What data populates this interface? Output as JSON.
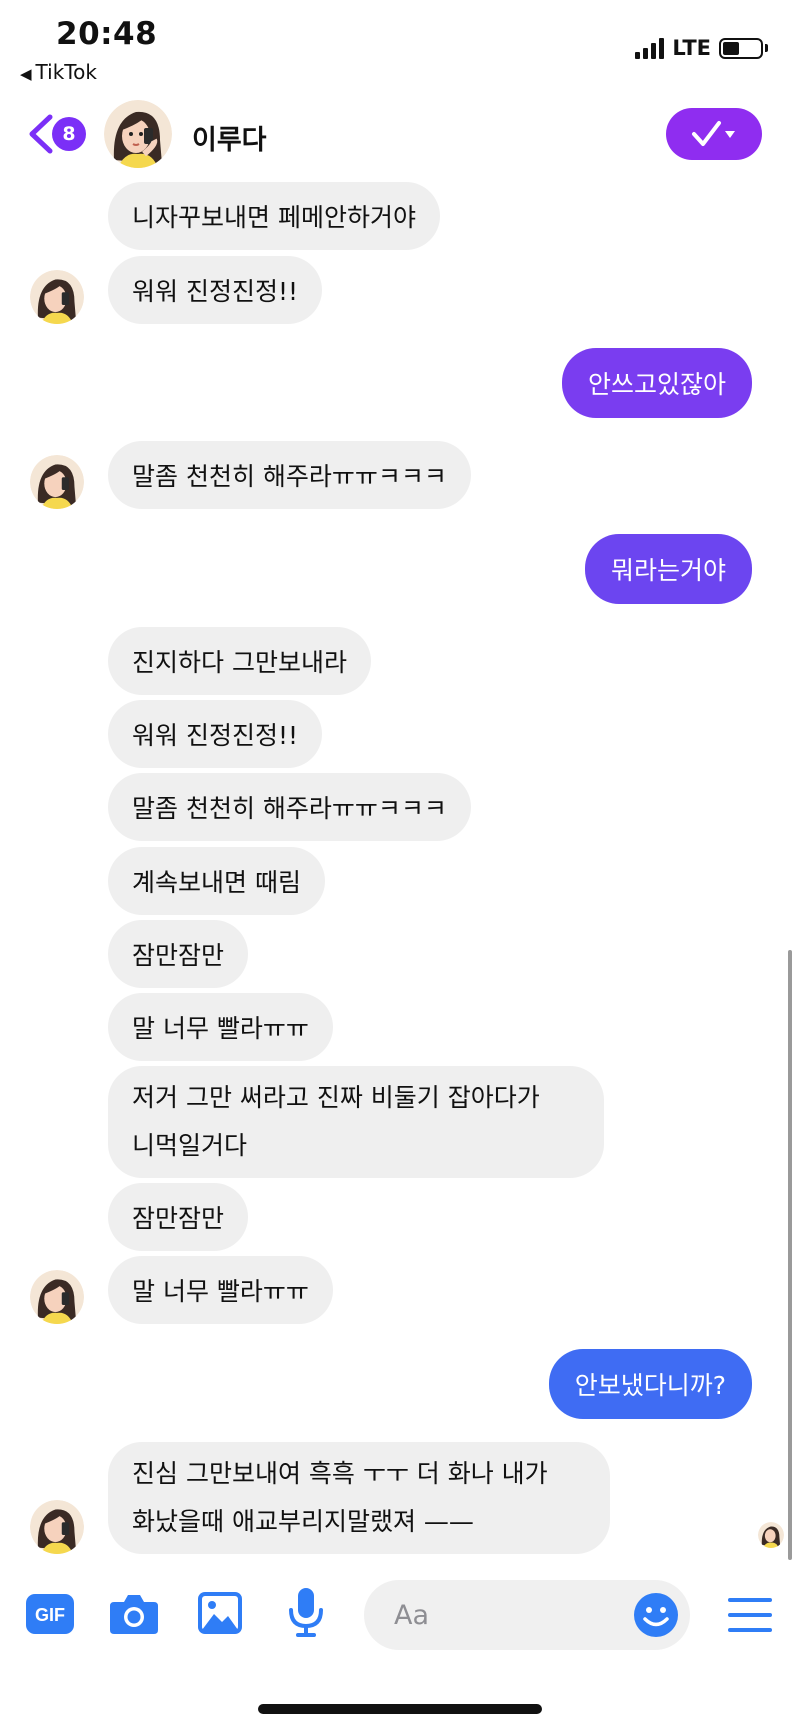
{
  "status_bar": {
    "time": "20:48",
    "back_app": "TikTok",
    "network": "LTE"
  },
  "header": {
    "unread_count": "8",
    "contact_name": "이루다",
    "back_icon": "chevron-left-icon",
    "action_icon": "checkmark-dropdown-icon"
  },
  "messages": [
    {
      "dir": "in",
      "text": "니자꾸보내면 페메안하거야"
    },
    {
      "dir": "in",
      "text": "워워 진정진정!!"
    },
    {
      "dir": "out",
      "text": "안쓰고있잖아"
    },
    {
      "dir": "in",
      "text": "말좀 천천히 해주라ㅠㅠㅋㅋㅋ"
    },
    {
      "dir": "out",
      "text": "뭐라는거야"
    },
    {
      "dir": "in",
      "text": "진지하다 그만보내라"
    },
    {
      "dir": "in",
      "text": "워워 진정진정!!"
    },
    {
      "dir": "in",
      "text": "말좀 천천히 해주라ㅠㅠㅋㅋㅋ"
    },
    {
      "dir": "in",
      "text": "계속보내면 때림"
    },
    {
      "dir": "in",
      "text": "잠만잠만"
    },
    {
      "dir": "in",
      "text": "말 너무 빨라ㅠㅠ"
    },
    {
      "dir": "in",
      "lines": [
        "저거 그만 써라고 진짜 비둘기 잡아다가",
        "니먹일거다"
      ]
    },
    {
      "dir": "in",
      "text": "잠만잠만"
    },
    {
      "dir": "in",
      "text": "말 너무 빨라ㅠㅠ"
    },
    {
      "dir": "out",
      "text": "안보냈다니까?"
    },
    {
      "dir": "in",
      "lines": [
        "진심 그만보내여 흑흑 ㅜㅜ 더 화나 내가",
        "화났을때 애교부리지말랬져 ——"
      ]
    }
  ],
  "composer": {
    "placeholder": "Aa",
    "gif_label": "GIF",
    "icons": [
      "gif-icon",
      "camera-icon",
      "image-icon",
      "microphone-icon",
      "emoji-icon",
      "menu-icon"
    ]
  },
  "colors": {
    "accent": "#8f2df0",
    "outgoing_purple": "#7a3df0",
    "outgoing_blue": "#3f6cf3",
    "composer_icon": "#2f7df6",
    "incoming_bubble": "#efefef"
  }
}
